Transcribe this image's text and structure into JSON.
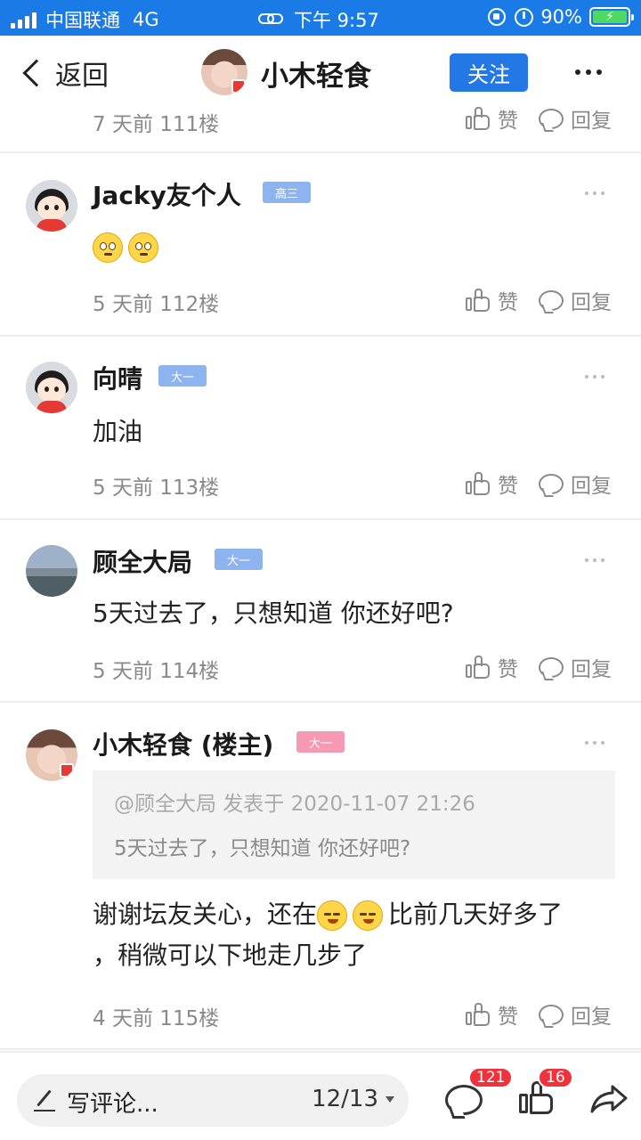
{
  "status_bar": {
    "carrier": "中国联通",
    "network": "4G",
    "time": "下午 9:57",
    "battery": "90%"
  },
  "nav": {
    "back_label": "返回",
    "title": "小木轻食",
    "follow_label": "关注"
  },
  "partial_row": {
    "meta": "7 天前  111楼",
    "like_label": "赞",
    "reply_label": "回复"
  },
  "posts": [
    {
      "username": "Jacky友个人",
      "level": "高三",
      "content": "",
      "content_emojis": [
        "crying-face-emoji",
        "crying-face-emoji"
      ],
      "meta": "5 天前  112楼",
      "like_label": "赞",
      "reply_label": "回复"
    },
    {
      "username": "向晴",
      "level": "大一",
      "content": "加油",
      "meta": "5 天前  113楼",
      "like_label": "赞",
      "reply_label": "回复"
    },
    {
      "username": "顾全大局",
      "level": "大一",
      "content": "5天过去了，只想知道 你还好吧?",
      "meta": "5 天前  114楼",
      "like_label": "赞",
      "reply_label": "回复"
    },
    {
      "username": "小木轻食 (楼主)",
      "level": "大一",
      "quote_header": "@顾全大局 发表于 2020-11-07 21:26",
      "quote_text": "5天过去了，只想知道 你还好吧?",
      "content_part1": "谢谢坛友关心，还在",
      "content_part2": "比前几天好多了",
      "content_line2": "，稍微可以下地走几步了",
      "meta": "4 天前  115楼",
      "like_label": "赞",
      "reply_label": "回复"
    }
  ],
  "bottom_bar": {
    "comment_placeholder": "写评论...",
    "page_indicator": "12/13",
    "comment_count": "121",
    "like_count": "16"
  },
  "colors": {
    "status_bar": "#1a7be6",
    "follow_button": "#2478e6",
    "level_badge": "#8db4ee",
    "owner_badge": "#f59ab2",
    "count_badge": "#f0323c"
  }
}
